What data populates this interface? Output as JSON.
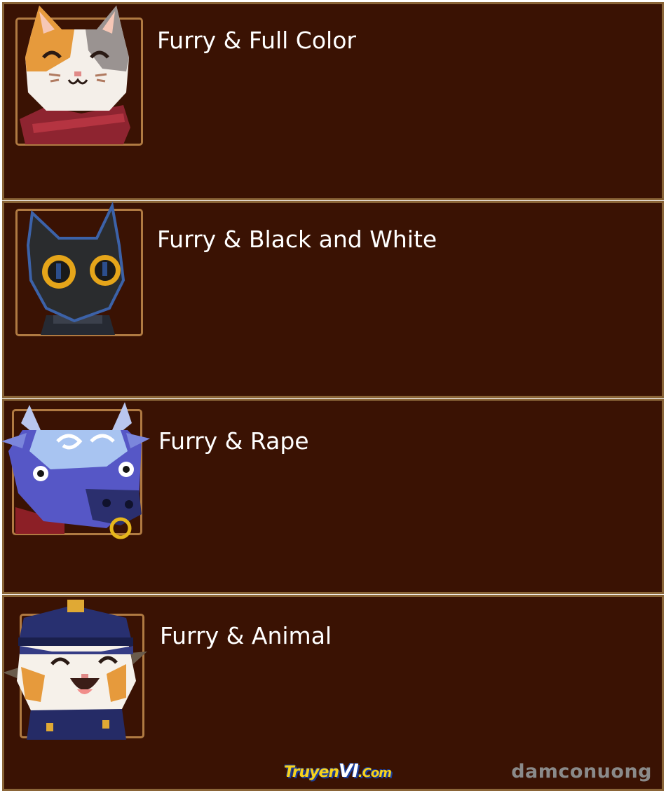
{
  "panels": [
    {
      "label": "Furry & Full Color",
      "avatar": "calico-cat-scarf-avatar"
    },
    {
      "label": "Furry & Black and White",
      "avatar": "black-cat-avatar"
    },
    {
      "label": "Furry & Rape",
      "avatar": "blue-bull-nose-ring-avatar"
    },
    {
      "label": "Furry & Animal",
      "avatar": "cat-police-uniform-avatar"
    }
  ],
  "watermark": {
    "site_part1": "Truyen",
    "site_part2": "VI",
    "site_part3": ".Com",
    "author": "damconuong"
  },
  "colors": {
    "panel_bg": "#3a1203",
    "panel_border": "#8a6538",
    "frame": "#b07a42",
    "label_text": "#ffffff"
  }
}
